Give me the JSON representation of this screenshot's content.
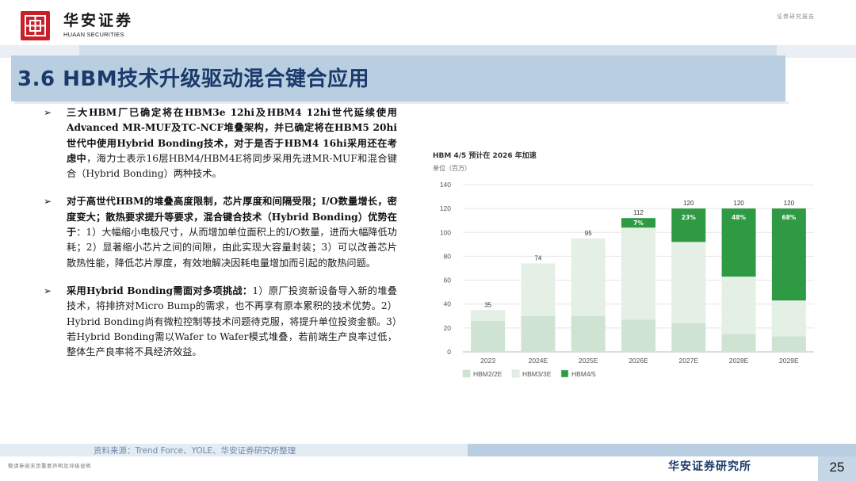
{
  "header": {
    "logo_cn": "华安证券",
    "logo_en": "HUAAN SECURITIES",
    "report_type": "证券研究报告"
  },
  "title": "3.6 HBM技术升级驱动混合键合应用",
  "bullets": [
    {
      "lead": "三大HBM厂已确定将在HBM3e 12hi及HBM4 12hi世代延续使用Advanced MR-MUF及TC-NCF堆叠架构，并已确定将在HBM5 20hi世代中使用Hybrid Bonding技术，对于是否于HBM4 16hi采用还在考虑中",
      "body": "，海力士表示16层HBM4/HBM4E将同步采用先进MR-MUF和混合键合（Hybrid Bonding）两种技术。"
    },
    {
      "lead": "对于高世代HBM的堆叠高度限制，芯片厚度和间隔受限；I/O数量增长，密度变大；散热要求提升等要求，混合键合技术（Hybrid Bonding）优势在于",
      "body": "：1）大幅缩小电极尺寸，从而增加单位面积上的I/O数量，进而大幅降低功耗；2）显著缩小芯片之间的间隙，由此实现大容量封装；3）可以改善芯片散热性能，降低芯片厚度，有效地解决因耗电量增加而引起的散热问题。"
    },
    {
      "lead": "采用Hybrid Bonding需面对多项挑战：",
      "body": "1）原厂投资新设备导入新的堆叠技术，将排挤对Micro Bump的需求，也不再享有原本累积的技术优势。2）Hybrid Bonding尚有微粒控制等技术问题待克服，将提升单位投资金额。3）若Hybrid Bonding需以Wafer to Wafer模式堆叠，若前端生产良率过低，整体生产良率将不具经济效益。"
    }
  ],
  "bullet_marker": "➢",
  "source": "资料来源：Trend Force、YOLE、华安证券研究所整理",
  "footer": {
    "disclaimer": "敬请参阅末页重要声明及评级说明",
    "name": "华安证券研究所",
    "page": "25"
  },
  "colors": {
    "brand_red": "#c8202b",
    "title_blue": "#1b3a6b",
    "hbm2": "#cfe3d3",
    "hbm3": "#e4efe6",
    "hbm45": "#2f9a44"
  },
  "chart_data": {
    "type": "bar",
    "stacked": true,
    "title": "HBM 4/5 预计在 2026 年加速",
    "unit": "单位（百万）",
    "categories": [
      "2023",
      "2024E",
      "2025E",
      "2026E",
      "2027E",
      "2028E",
      "2029E"
    ],
    "totals": [
      35,
      74,
      95,
      112,
      120,
      120,
      120
    ],
    "series": [
      {
        "name": "HBM2/2E",
        "color": "#cfe3d3",
        "values": [
          26,
          30,
          30,
          27,
          24,
          15,
          13
        ]
      },
      {
        "name": "HBM3/3E",
        "color": "#e4efe6",
        "values": [
          9,
          44,
          65,
          77,
          68,
          48,
          30
        ]
      },
      {
        "name": "HBM4/5",
        "color": "#2f9a44",
        "values": [
          0,
          0,
          0,
          8,
          28,
          57,
          77
        ]
      }
    ],
    "share_labels": [
      "",
      "",
      "",
      "7%",
      "23%",
      "48%",
      "68%"
    ],
    "ylim": [
      0,
      140
    ],
    "yticks": [
      0,
      20,
      40,
      60,
      80,
      100,
      120,
      140
    ],
    "grid": true,
    "legend": "bottom-left"
  }
}
